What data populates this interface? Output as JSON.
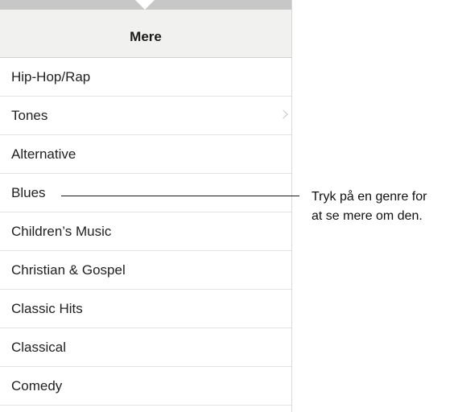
{
  "header": {
    "title": "Mere"
  },
  "genres": [
    {
      "label": "Hip-Hop/Rap",
      "chevron": false
    },
    {
      "label": "Tones",
      "chevron": true
    },
    {
      "label": "Alternative",
      "chevron": false
    },
    {
      "label": "Blues",
      "chevron": false
    },
    {
      "label": "Children’s Music",
      "chevron": false
    },
    {
      "label": "Christian & Gospel",
      "chevron": false
    },
    {
      "label": "Classic Hits",
      "chevron": false
    },
    {
      "label": "Classical",
      "chevron": false
    },
    {
      "label": "Comedy",
      "chevron": false
    }
  ],
  "callout": {
    "line1": "Tryk på en genre for",
    "line2": "at se mere om den."
  }
}
